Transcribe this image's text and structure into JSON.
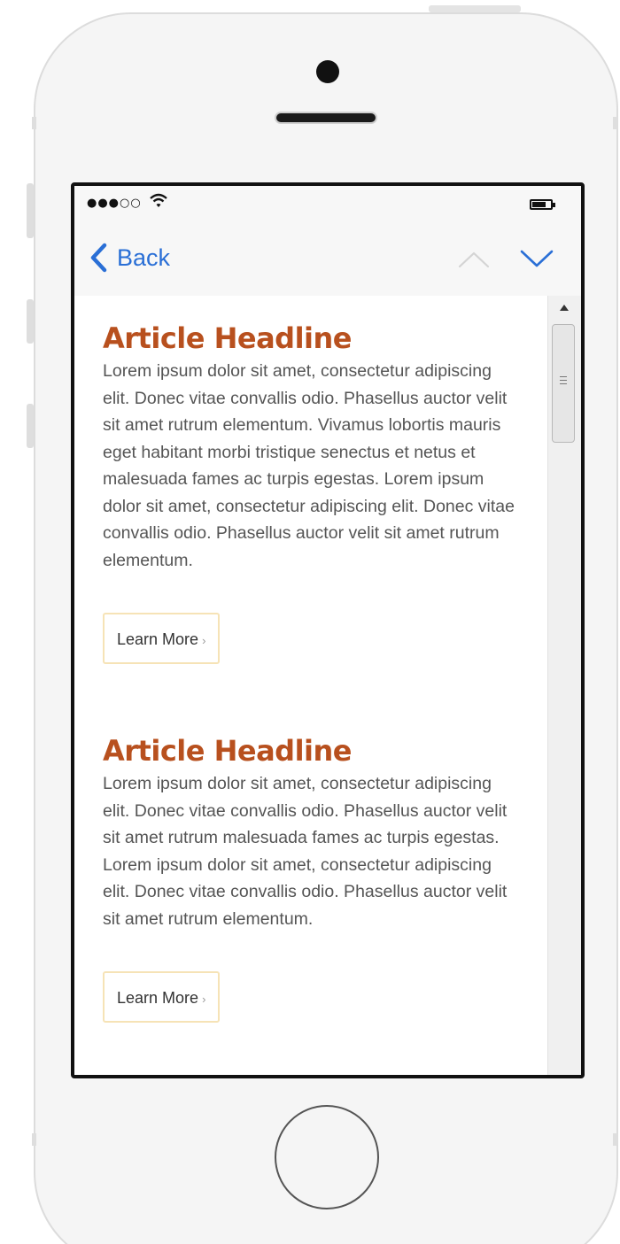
{
  "status_bar": {
    "signal": "●●●○○",
    "wifi_icon": "wifi-icon",
    "battery_icon": "battery-icon"
  },
  "nav": {
    "back_label": "Back",
    "back_icon": "chevron-left-icon",
    "up_icon": "chevron-up-icon",
    "down_icon": "chevron-down-icon",
    "accent_color": "#2a6fd6"
  },
  "articles": [
    {
      "headline": "Article Headline",
      "body": "Lorem ipsum dolor sit amet, consectetur adipiscing elit. Donec vitae convallis odio. Phasellus auctor velit sit amet rutrum elementum. Vivamus lobortis mauris eget habitant morbi tristique senectus et netus et malesuada fames ac turpis egestas. Lorem ipsum dolor sit amet, consectetur adipiscing elit. Donec vitae convallis odio. Phasellus auctor velit sit amet rutrum elementum.",
      "button_label": "Learn More",
      "button_arrow": "›"
    },
    {
      "headline": "Article Headline",
      "body": "Lorem ipsum dolor sit amet, consectetur adipiscing elit. Donec vitae convallis odio. Phasellus auctor velit sit amet rutrum malesuada fames ac turpis egestas. Lorem ipsum dolor sit amet, consectetur adipiscing elit. Donec vitae convallis odio. Phasellus auctor velit sit amet rutrum elementum.",
      "button_label": "Learn More",
      "button_arrow": "›"
    }
  ],
  "colors": {
    "headline": "#b8501e",
    "body_text": "#555555",
    "button_border": "#f6e3b6"
  }
}
